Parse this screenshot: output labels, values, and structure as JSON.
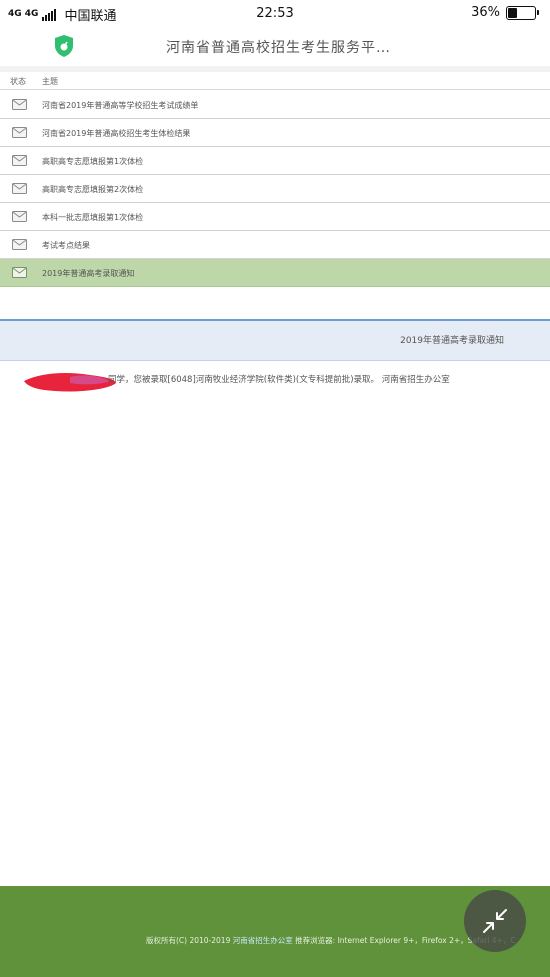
{
  "status_bar": {
    "network": "4G 4G",
    "carrier": "中国联通",
    "time": "22:53",
    "battery": "36%",
    "battery_level": 0.36
  },
  "header": {
    "title": "河南省普通高校招生考生服务平…",
    "app_icon": "shield-icon"
  },
  "table": {
    "col_status": "状态",
    "col_subject": "主题",
    "rows": [
      {
        "subject": "河南省2019年普通高等学校招生考试成绩单",
        "icon": "mail-icon",
        "selected": false
      },
      {
        "subject": "河南省2019年普通高校招生考生体检结果",
        "icon": "mail-icon",
        "selected": false
      },
      {
        "subject": "高职高专志愿填报第1次体检",
        "icon": "mail-icon",
        "selected": false
      },
      {
        "subject": "高职高专志愿填报第2次体检",
        "icon": "mail-icon",
        "selected": false
      },
      {
        "subject": "本科一批志愿填报第1次体检",
        "icon": "mail-icon",
        "selected": false
      },
      {
        "subject": "考试考点结果",
        "icon": "mail-icon",
        "selected": false
      },
      {
        "subject": "2019年普通高考录取通知",
        "icon": "mail-icon",
        "selected": true
      }
    ]
  },
  "notice": {
    "title": "2019年普通高考录取通知",
    "body": "同学，您被录取[6048]河南牧业经济学院(软件类)(文专科提前批)录取。 河南省招生办公室"
  },
  "footer": {
    "copyright": "版权所有(C) 2010-2019",
    "org": "河南省招生办公室",
    "browser_label": "推荐浏览器:",
    "browsers": "Internet Explorer 9+，Firefox 2+，Safari 4+，C"
  },
  "fab": {
    "icon": "collapse-arrows-icon"
  },
  "colors": {
    "selected_row": "#bdd7a8",
    "notice_bg": "#e6ecf5",
    "notice_border": "#6c9ed1",
    "footer_bg": "#5f923b",
    "shield": "#2fbf71"
  }
}
